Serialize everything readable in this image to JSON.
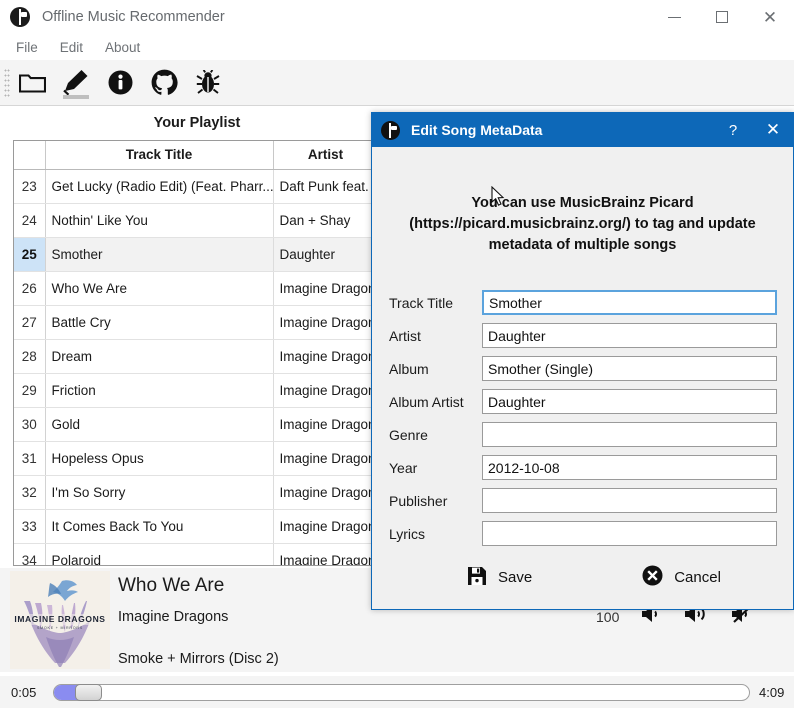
{
  "window": {
    "title": "Offline Music Recommender",
    "icon": "music-app-icon",
    "controls": {
      "minimize": "—",
      "maximize": "□",
      "close": "✕"
    }
  },
  "menubar": {
    "items": [
      {
        "label": "File",
        "name": "menu-file"
      },
      {
        "label": "Edit",
        "name": "menu-edit"
      },
      {
        "label": "About",
        "name": "menu-about"
      }
    ]
  },
  "toolbar": {
    "buttons": [
      {
        "name": "open-folder-icon",
        "label": "Open Folder",
        "active": false
      },
      {
        "name": "edit-pencil-icon",
        "label": "Edit Metadata",
        "active": true
      },
      {
        "name": "info-icon",
        "label": "Info",
        "active": false
      },
      {
        "name": "github-icon",
        "label": "GitHub",
        "active": false
      },
      {
        "name": "bug-icon",
        "label": "Report Bug",
        "active": false
      }
    ]
  },
  "playlist": {
    "heading": "Your Playlist",
    "columns": [
      "",
      "Track Title",
      "Artist"
    ],
    "selected_index": 25,
    "rows": [
      {
        "num": "23",
        "title": "Get Lucky (Radio Edit) (Feat. Pharr...",
        "artist": "Daft Punk feat. ..."
      },
      {
        "num": "24",
        "title": "Nothin' Like You",
        "artist": "Dan + Shay"
      },
      {
        "num": "25",
        "title": "Smother",
        "artist": "Daughter"
      },
      {
        "num": "26",
        "title": "Who We Are",
        "artist": "Imagine Dragons"
      },
      {
        "num": "27",
        "title": "Battle Cry",
        "artist": "Imagine Dragons"
      },
      {
        "num": "28",
        "title": "Dream",
        "artist": "Imagine Dragons"
      },
      {
        "num": "29",
        "title": "Friction",
        "artist": "Imagine Dragons"
      },
      {
        "num": "30",
        "title": "Gold",
        "artist": "Imagine Dragons"
      },
      {
        "num": "31",
        "title": "Hopeless Opus",
        "artist": "Imagine Dragons"
      },
      {
        "num": "32",
        "title": "I'm So Sorry",
        "artist": "Imagine Dragons"
      },
      {
        "num": "33",
        "title": "It Comes Back To You",
        "artist": "Imagine Dragons"
      },
      {
        "num": "34",
        "title": "Polaroid",
        "artist": "Imagine Dragons"
      }
    ]
  },
  "now_playing": {
    "album_art": "imagine-dragons-smoke-mirrors-cover",
    "track_title": "Who We Are",
    "artist": "Imagine Dragons",
    "album": "Smoke + Mirrors (Disc 2)",
    "volume_value": "100",
    "volume_buttons": [
      {
        "name": "volume-down-icon",
        "label": "Volume Down"
      },
      {
        "name": "volume-up-icon",
        "label": "Volume Up"
      },
      {
        "name": "volume-mute-icon",
        "label": "Mute"
      }
    ]
  },
  "seek": {
    "current_time": "0:05",
    "total_time": "4:09",
    "progress_percent": 2
  },
  "dialog": {
    "icon": "music-app-icon",
    "title": "Edit Song MetaData",
    "help_label": "?",
    "close_label": "✕",
    "note": "You can use  MusicBrainz Picard (https://picard.musicbrainz.org/) to tag and update metadata of multiple songs",
    "fields": [
      {
        "label": "Track Title",
        "value": "Smother",
        "placeholder": "",
        "focused": true
      },
      {
        "label": "Artist",
        "value": "Daughter",
        "placeholder": "",
        "focused": false
      },
      {
        "label": "Album",
        "value": "Smother (Single)",
        "placeholder": "",
        "focused": false
      },
      {
        "label": "Album Artist",
        "value": "Daughter",
        "placeholder": "",
        "focused": false
      },
      {
        "label": "Genre",
        "value": "",
        "placeholder": "",
        "focused": false
      },
      {
        "label": "Year",
        "value": "2012-10-08",
        "placeholder": "",
        "focused": false
      },
      {
        "label": "Publisher",
        "value": "",
        "placeholder": "",
        "focused": false
      },
      {
        "label": "Lyrics",
        "value": "",
        "placeholder": "",
        "focused": false
      }
    ],
    "save_label": "Save",
    "cancel_label": "Cancel"
  },
  "colors": {
    "dialog_titlebar": "#0d68b8",
    "selection_blue": "#cde3f7",
    "seek_fill": "#8a8cf0",
    "toolbar_bg": "#f4f4f4"
  }
}
